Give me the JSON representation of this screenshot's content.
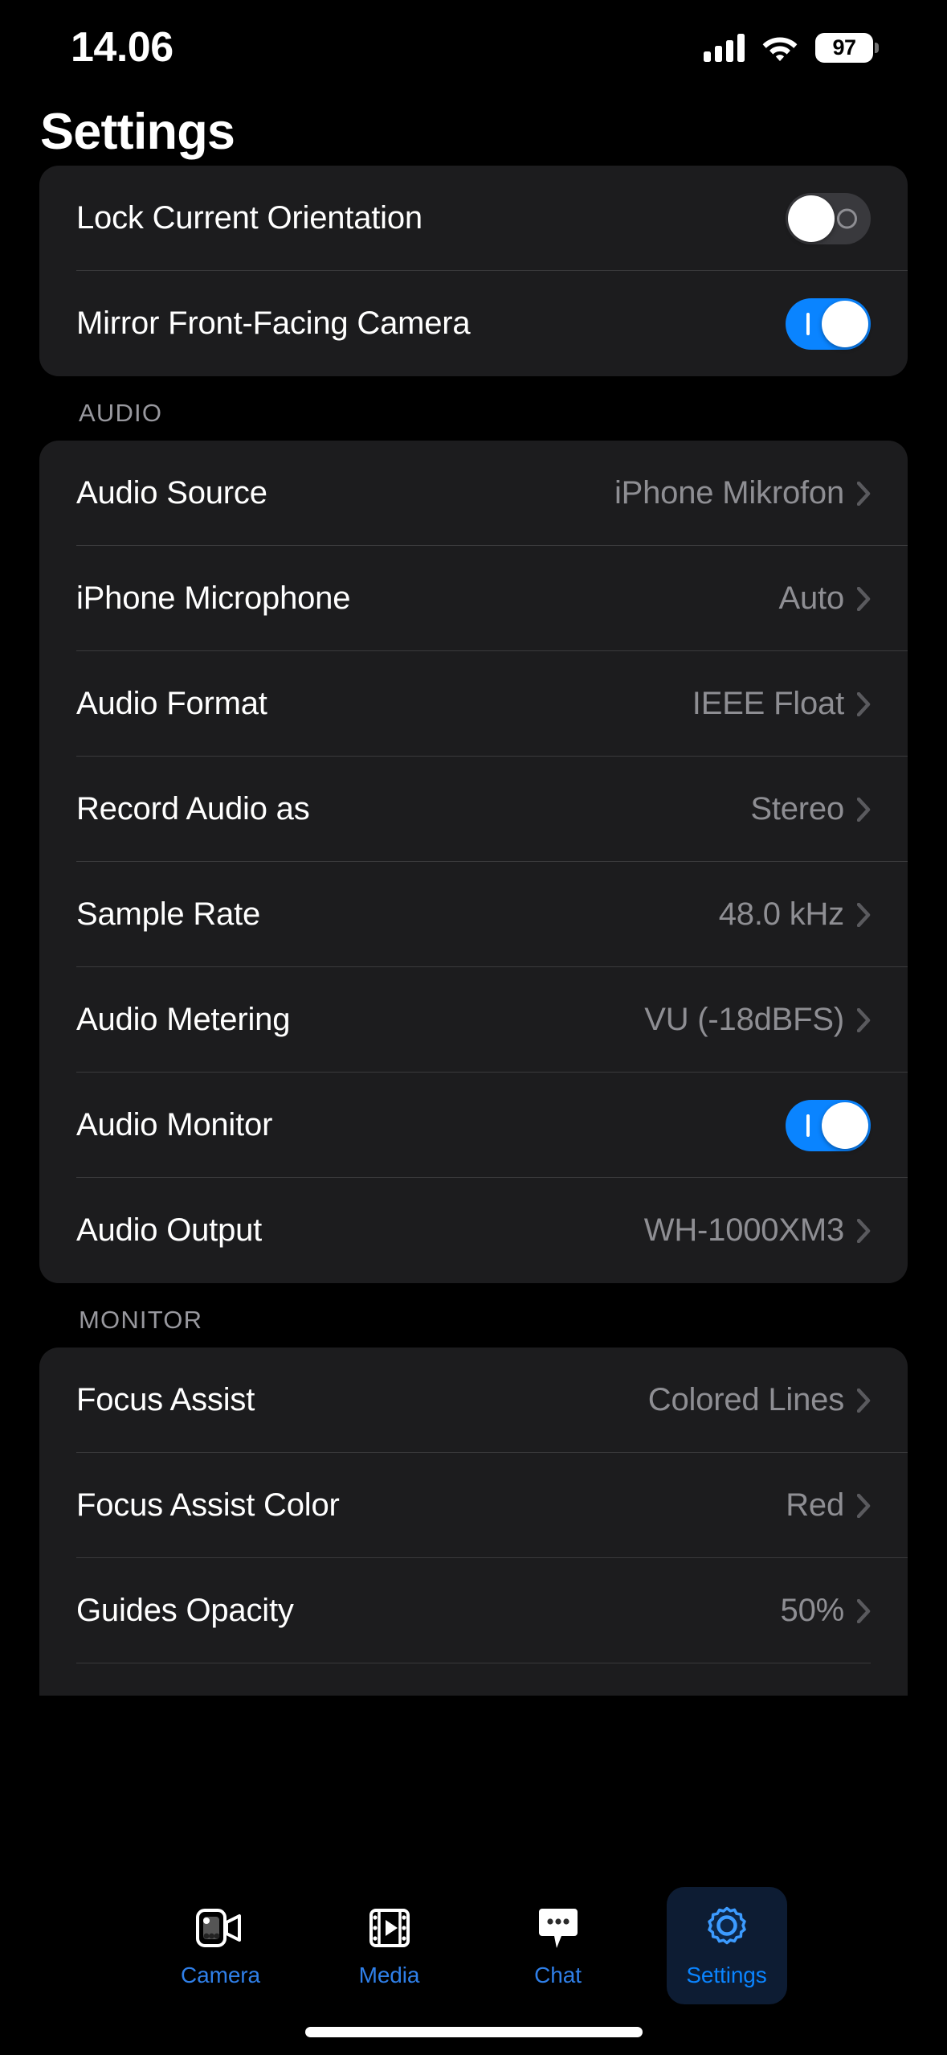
{
  "status_bar": {
    "time": "14.06",
    "signal_icon": "cellular-bars-icon",
    "wifi_icon": "wifi-icon",
    "battery_level": "97",
    "battery_icon": "battery-icon"
  },
  "header": {
    "title": "Settings"
  },
  "colors": {
    "accent_blue": "#0a84ff",
    "toggle_off_track": "#39393d",
    "card_background": "#1c1c1e",
    "page_background": "#000000",
    "value_gray": "#8e8e93",
    "section_header_gray": "#98989e",
    "separator": "#3a3a3c",
    "active_tab_background": "#0d1c33"
  },
  "sections": [
    {
      "header": "",
      "rows": [
        {
          "label": "Lock Current Orientation",
          "type": "toggle",
          "state": "off",
          "off_glyph": "O",
          "name": "lock-current-orientation"
        },
        {
          "label": "Mirror Front-Facing Camera",
          "type": "toggle",
          "state": "on",
          "on_glyph": "I",
          "name": "mirror-front-facing-camera"
        }
      ]
    },
    {
      "header": "AUDIO",
      "rows": [
        {
          "label": "Audio Source",
          "type": "disclosure",
          "value": "iPhone Mikrofon",
          "name": "audio-source"
        },
        {
          "label": "iPhone Microphone",
          "type": "disclosure",
          "value": "Auto",
          "name": "iphone-microphone"
        },
        {
          "label": "Audio Format",
          "type": "disclosure",
          "value": "IEEE Float",
          "name": "audio-format"
        },
        {
          "label": "Record Audio as",
          "type": "disclosure",
          "value": "Stereo",
          "name": "record-audio-as"
        },
        {
          "label": "Sample Rate",
          "type": "disclosure",
          "value": "48.0 kHz",
          "name": "sample-rate"
        },
        {
          "label": "Audio Metering",
          "type": "disclosure",
          "value": "VU (-18dBFS)",
          "name": "audio-metering"
        },
        {
          "label": "Audio Monitor",
          "type": "toggle",
          "state": "on",
          "on_glyph": "I",
          "name": "audio-monitor"
        },
        {
          "label": "Audio Output",
          "type": "disclosure",
          "value": "WH-1000XM3",
          "name": "audio-output"
        }
      ]
    },
    {
      "header": "MONITOR",
      "rows": [
        {
          "label": "Focus Assist",
          "type": "disclosure",
          "value": "Colored Lines",
          "name": "focus-assist"
        },
        {
          "label": "Focus Assist Color",
          "type": "disclosure",
          "value": "Red",
          "name": "focus-assist-color"
        },
        {
          "label": "Guides Opacity",
          "type": "disclosure",
          "value": "50%",
          "name": "guides-opacity"
        }
      ]
    }
  ],
  "tab_bar": {
    "items": [
      {
        "label": "Camera",
        "icon": "video-camera-icon",
        "active": false
      },
      {
        "label": "Media",
        "icon": "film-play-icon",
        "active": false
      },
      {
        "label": "Chat",
        "icon": "chat-bubble-icon",
        "active": false
      },
      {
        "label": "Settings",
        "icon": "gear-icon",
        "active": true
      }
    ]
  }
}
